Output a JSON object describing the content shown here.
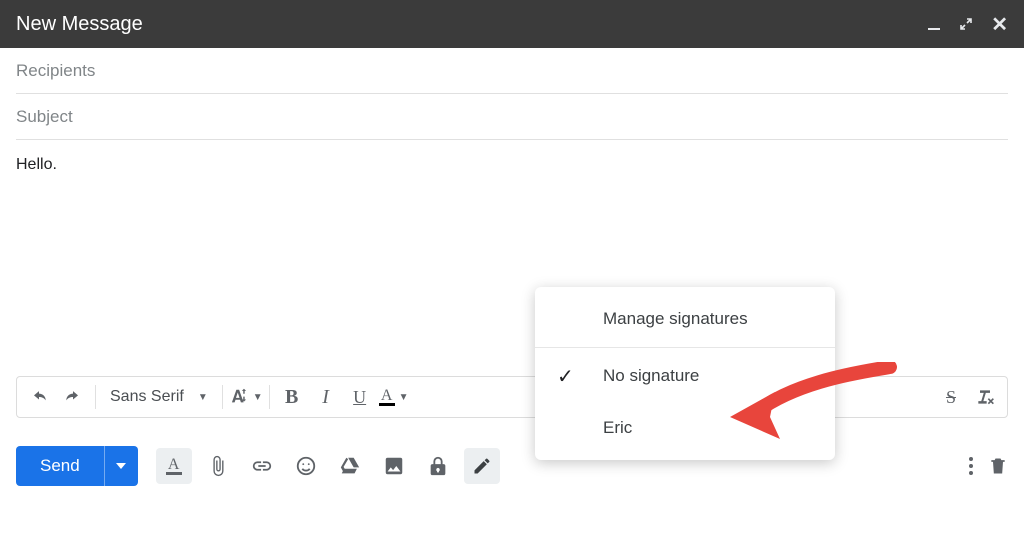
{
  "titlebar": {
    "title": "New Message"
  },
  "fields": {
    "recipients_placeholder": "Recipients",
    "subject_placeholder": "Subject"
  },
  "body": {
    "content": "Hello."
  },
  "format_toolbar": {
    "font": "Sans Serif"
  },
  "actions": {
    "send_label": "Send"
  },
  "signature_menu": {
    "manage_label": "Manage signatures",
    "no_signature_label": "No signature",
    "items": [
      "Eric"
    ],
    "selected": "No signature"
  }
}
